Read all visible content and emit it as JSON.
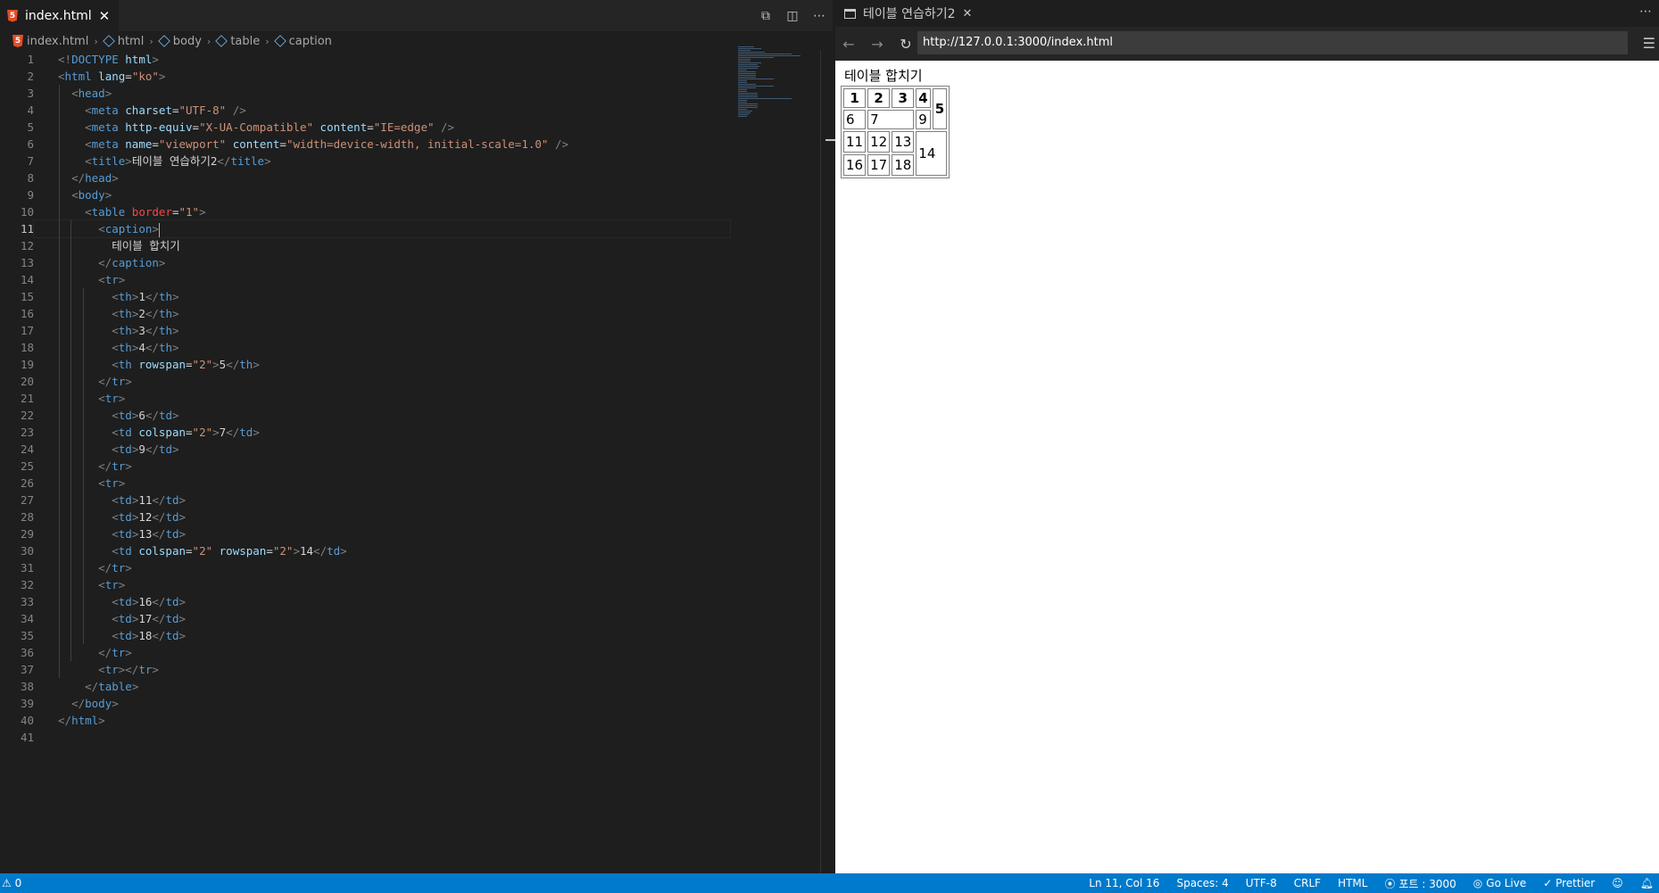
{
  "editor": {
    "tab": {
      "filename": "index.html",
      "close": "✕"
    },
    "breadcrumb": [
      "index.html",
      "html",
      "body",
      "table",
      "caption"
    ],
    "lines": [
      [
        [
          "ang",
          "<!"
        ],
        [
          "tag",
          "DOCTYPE "
        ],
        [
          "attr",
          "html"
        ],
        [
          "ang",
          ">"
        ]
      ],
      [
        [
          "ang",
          "<"
        ],
        [
          "tag",
          "html "
        ],
        [
          "attr",
          "lang"
        ],
        [
          "plain",
          "="
        ],
        [
          "str",
          "\"ko\""
        ],
        [
          "ang",
          ">"
        ]
      ],
      [
        [
          "plain",
          "  "
        ],
        [
          "ang",
          "<"
        ],
        [
          "tag",
          "head"
        ],
        [
          "ang",
          ">"
        ]
      ],
      [
        [
          "plain",
          "    "
        ],
        [
          "ang",
          "<"
        ],
        [
          "tag",
          "meta "
        ],
        [
          "attr",
          "charset"
        ],
        [
          "plain",
          "="
        ],
        [
          "str",
          "\"UTF-8\""
        ],
        [
          "ang",
          " />"
        ]
      ],
      [
        [
          "plain",
          "    "
        ],
        [
          "ang",
          "<"
        ],
        [
          "tag",
          "meta "
        ],
        [
          "attr",
          "http-equiv"
        ],
        [
          "plain",
          "="
        ],
        [
          "str",
          "\"X-UA-Compatible\""
        ],
        [
          "plain",
          " "
        ],
        [
          "attr",
          "content"
        ],
        [
          "plain",
          "="
        ],
        [
          "str",
          "\"IE=edge\""
        ],
        [
          "ang",
          " />"
        ]
      ],
      [
        [
          "plain",
          "    "
        ],
        [
          "ang",
          "<"
        ],
        [
          "tag",
          "meta "
        ],
        [
          "attr",
          "name"
        ],
        [
          "plain",
          "="
        ],
        [
          "str",
          "\"viewport\""
        ],
        [
          "plain",
          " "
        ],
        [
          "attr",
          "content"
        ],
        [
          "plain",
          "="
        ],
        [
          "str",
          "\"width=device-width, initial-scale=1.0\""
        ],
        [
          "ang",
          " />"
        ]
      ],
      [
        [
          "plain",
          "    "
        ],
        [
          "ang",
          "<"
        ],
        [
          "tag",
          "title"
        ],
        [
          "ang",
          ">"
        ],
        [
          "plain",
          "테이블 연습하기2"
        ],
        [
          "ang",
          "</"
        ],
        [
          "tag",
          "title"
        ],
        [
          "ang",
          ">"
        ]
      ],
      [
        [
          "plain",
          "  "
        ],
        [
          "ang",
          "</"
        ],
        [
          "tag",
          "head"
        ],
        [
          "ang",
          ">"
        ]
      ],
      [
        [
          "plain",
          "  "
        ],
        [
          "ang",
          "<"
        ],
        [
          "tag",
          "body"
        ],
        [
          "ang",
          ">"
        ]
      ],
      [
        [
          "plain",
          "    "
        ],
        [
          "ang",
          "<"
        ],
        [
          "tag",
          "table "
        ],
        [
          "attr-red",
          "border"
        ],
        [
          "plain",
          "="
        ],
        [
          "str",
          "\"1\""
        ],
        [
          "ang",
          ">"
        ]
      ],
      [
        [
          "plain",
          "      "
        ],
        [
          "ang",
          "<"
        ],
        [
          "tag",
          "caption"
        ],
        [
          "ang",
          ">"
        ]
      ],
      [
        [
          "plain",
          "        테이블 합치기"
        ]
      ],
      [
        [
          "plain",
          "      "
        ],
        [
          "ang",
          "</"
        ],
        [
          "tag",
          "caption"
        ],
        [
          "ang",
          ">"
        ]
      ],
      [
        [
          "plain",
          "      "
        ],
        [
          "ang",
          "<"
        ],
        [
          "tag",
          "tr"
        ],
        [
          "ang",
          ">"
        ]
      ],
      [
        [
          "plain",
          "        "
        ],
        [
          "ang",
          "<"
        ],
        [
          "tag",
          "th"
        ],
        [
          "ang",
          ">"
        ],
        [
          "plain",
          "1"
        ],
        [
          "ang",
          "</"
        ],
        [
          "tag",
          "th"
        ],
        [
          "ang",
          ">"
        ]
      ],
      [
        [
          "plain",
          "        "
        ],
        [
          "ang",
          "<"
        ],
        [
          "tag",
          "th"
        ],
        [
          "ang",
          ">"
        ],
        [
          "plain",
          "2"
        ],
        [
          "ang",
          "</"
        ],
        [
          "tag",
          "th"
        ],
        [
          "ang",
          ">"
        ]
      ],
      [
        [
          "plain",
          "        "
        ],
        [
          "ang",
          "<"
        ],
        [
          "tag",
          "th"
        ],
        [
          "ang",
          ">"
        ],
        [
          "plain",
          "3"
        ],
        [
          "ang",
          "</"
        ],
        [
          "tag",
          "th"
        ],
        [
          "ang",
          ">"
        ]
      ],
      [
        [
          "plain",
          "        "
        ],
        [
          "ang",
          "<"
        ],
        [
          "tag",
          "th"
        ],
        [
          "ang",
          ">"
        ],
        [
          "plain",
          "4"
        ],
        [
          "ang",
          "</"
        ],
        [
          "tag",
          "th"
        ],
        [
          "ang",
          ">"
        ]
      ],
      [
        [
          "plain",
          "        "
        ],
        [
          "ang",
          "<"
        ],
        [
          "tag",
          "th "
        ],
        [
          "attr",
          "rowspan"
        ],
        [
          "plain",
          "="
        ],
        [
          "str",
          "\"2\""
        ],
        [
          "ang",
          ">"
        ],
        [
          "plain",
          "5"
        ],
        [
          "ang",
          "</"
        ],
        [
          "tag",
          "th"
        ],
        [
          "ang",
          ">"
        ]
      ],
      [
        [
          "plain",
          "      "
        ],
        [
          "ang",
          "</"
        ],
        [
          "tag",
          "tr"
        ],
        [
          "ang",
          ">"
        ]
      ],
      [
        [
          "plain",
          "      "
        ],
        [
          "ang",
          "<"
        ],
        [
          "tag",
          "tr"
        ],
        [
          "ang",
          ">"
        ]
      ],
      [
        [
          "plain",
          "        "
        ],
        [
          "ang",
          "<"
        ],
        [
          "tag",
          "td"
        ],
        [
          "ang",
          ">"
        ],
        [
          "plain",
          "6"
        ],
        [
          "ang",
          "</"
        ],
        [
          "tag",
          "td"
        ],
        [
          "ang",
          ">"
        ]
      ],
      [
        [
          "plain",
          "        "
        ],
        [
          "ang",
          "<"
        ],
        [
          "tag",
          "td "
        ],
        [
          "attr",
          "colspan"
        ],
        [
          "plain",
          "="
        ],
        [
          "str",
          "\"2\""
        ],
        [
          "ang",
          ">"
        ],
        [
          "plain",
          "7"
        ],
        [
          "ang",
          "</"
        ],
        [
          "tag",
          "td"
        ],
        [
          "ang",
          ">"
        ]
      ],
      [
        [
          "plain",
          "        "
        ],
        [
          "ang",
          "<"
        ],
        [
          "tag",
          "td"
        ],
        [
          "ang",
          ">"
        ],
        [
          "plain",
          "9"
        ],
        [
          "ang",
          "</"
        ],
        [
          "tag",
          "td"
        ],
        [
          "ang",
          ">"
        ]
      ],
      [
        [
          "plain",
          "      "
        ],
        [
          "ang",
          "</"
        ],
        [
          "tag",
          "tr"
        ],
        [
          "ang",
          ">"
        ]
      ],
      [
        [
          "plain",
          "      "
        ],
        [
          "ang",
          "<"
        ],
        [
          "tag",
          "tr"
        ],
        [
          "ang",
          ">"
        ]
      ],
      [
        [
          "plain",
          "        "
        ],
        [
          "ang",
          "<"
        ],
        [
          "tag",
          "td"
        ],
        [
          "ang",
          ">"
        ],
        [
          "plain",
          "11"
        ],
        [
          "ang",
          "</"
        ],
        [
          "tag",
          "td"
        ],
        [
          "ang",
          ">"
        ]
      ],
      [
        [
          "plain",
          "        "
        ],
        [
          "ang",
          "<"
        ],
        [
          "tag",
          "td"
        ],
        [
          "ang",
          ">"
        ],
        [
          "plain",
          "12"
        ],
        [
          "ang",
          "</"
        ],
        [
          "tag",
          "td"
        ],
        [
          "ang",
          ">"
        ]
      ],
      [
        [
          "plain",
          "        "
        ],
        [
          "ang",
          "<"
        ],
        [
          "tag",
          "td"
        ],
        [
          "ang",
          ">"
        ],
        [
          "plain",
          "13"
        ],
        [
          "ang",
          "</"
        ],
        [
          "tag",
          "td"
        ],
        [
          "ang",
          ">"
        ]
      ],
      [
        [
          "plain",
          "        "
        ],
        [
          "ang",
          "<"
        ],
        [
          "tag",
          "td "
        ],
        [
          "attr",
          "colspan"
        ],
        [
          "plain",
          "="
        ],
        [
          "str",
          "\"2\""
        ],
        [
          "plain",
          " "
        ],
        [
          "attr",
          "rowspan"
        ],
        [
          "plain",
          "="
        ],
        [
          "str",
          "\"2\""
        ],
        [
          "ang",
          ">"
        ],
        [
          "plain",
          "14"
        ],
        [
          "ang",
          "</"
        ],
        [
          "tag",
          "td"
        ],
        [
          "ang",
          ">"
        ]
      ],
      [
        [
          "plain",
          "      "
        ],
        [
          "ang",
          "</"
        ],
        [
          "tag",
          "tr"
        ],
        [
          "ang",
          ">"
        ]
      ],
      [
        [
          "plain",
          "      "
        ],
        [
          "ang",
          "<"
        ],
        [
          "tag",
          "tr"
        ],
        [
          "ang",
          ">"
        ]
      ],
      [
        [
          "plain",
          "        "
        ],
        [
          "ang",
          "<"
        ],
        [
          "tag",
          "td"
        ],
        [
          "ang",
          ">"
        ],
        [
          "plain",
          "16"
        ],
        [
          "ang",
          "</"
        ],
        [
          "tag",
          "td"
        ],
        [
          "ang",
          ">"
        ]
      ],
      [
        [
          "plain",
          "        "
        ],
        [
          "ang",
          "<"
        ],
        [
          "tag",
          "td"
        ],
        [
          "ang",
          ">"
        ],
        [
          "plain",
          "17"
        ],
        [
          "ang",
          "</"
        ],
        [
          "tag",
          "td"
        ],
        [
          "ang",
          ">"
        ]
      ],
      [
        [
          "plain",
          "        "
        ],
        [
          "ang",
          "<"
        ],
        [
          "tag",
          "td"
        ],
        [
          "ang",
          ">"
        ],
        [
          "plain",
          "18"
        ],
        [
          "ang",
          "</"
        ],
        [
          "tag",
          "td"
        ],
        [
          "ang",
          ">"
        ]
      ],
      [
        [
          "plain",
          "      "
        ],
        [
          "ang",
          "</"
        ],
        [
          "tag",
          "tr"
        ],
        [
          "ang",
          ">"
        ]
      ],
      [
        [
          "plain",
          "      "
        ],
        [
          "ang",
          "<"
        ],
        [
          "tag",
          "tr"
        ],
        [
          "ang",
          "></"
        ],
        [
          "tag",
          "tr"
        ],
        [
          "ang",
          ">"
        ]
      ],
      [
        [
          "plain",
          "    "
        ],
        [
          "ang",
          "</"
        ],
        [
          "tag",
          "table"
        ],
        [
          "ang",
          ">"
        ]
      ],
      [
        [
          "plain",
          "  "
        ],
        [
          "ang",
          "</"
        ],
        [
          "tag",
          "body"
        ],
        [
          "ang",
          ">"
        ]
      ],
      [
        [
          "ang",
          "</"
        ],
        [
          "tag",
          "html"
        ],
        [
          "ang",
          ">"
        ]
      ],
      []
    ],
    "current_line": 11
  },
  "preview": {
    "tab_title": "테이블 연습하기2",
    "tab_close": "✕",
    "url": "http://127.0.0.1:3000/index.html",
    "caption": "테이블 합치기",
    "table": {
      "header": [
        "1",
        "2",
        "3",
        "4",
        "5"
      ],
      "row2": [
        "6",
        "7",
        "9"
      ],
      "row3": [
        "11",
        "12",
        "13",
        "14"
      ],
      "row4": [
        "16",
        "17",
        "18"
      ]
    }
  },
  "statusbar": {
    "left": "⚠ 0",
    "position": "Ln 11, Col 16",
    "spaces": "Spaces: 4",
    "encoding": "UTF-8",
    "eol": "CRLF",
    "language": "HTML",
    "port": "포트 : 3000",
    "golive": "Go Live",
    "prettier": "✓ Prettier"
  },
  "colors": {
    "statusbar": "#007acc",
    "editor_bg": "#1e1e1e",
    "tag": "#569cd6",
    "attribute": "#9cdcfe",
    "string": "#ce9178"
  }
}
